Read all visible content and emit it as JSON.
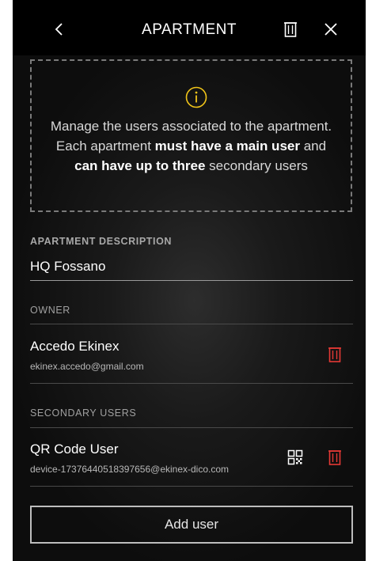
{
  "header": {
    "title": "APARTMENT"
  },
  "info": {
    "text_1": "Manage the users associated to the apartment. Each apartment ",
    "bold_1": "must have a main user",
    "text_2": " and ",
    "bold_2": "can have up to three",
    "text_3": " secondary users"
  },
  "description": {
    "label": "APARTMENT DESCRIPTION",
    "value": "HQ Fossano"
  },
  "owner": {
    "label": "OWNER",
    "name": "Accedo Ekinex",
    "email": "ekinex.accedo@gmail.com"
  },
  "secondary": {
    "label": "SECONDARY USERS",
    "users": [
      {
        "name": "QR Code User",
        "email": "device-17376440518397656@ekinex-dico.com"
      }
    ]
  },
  "add_user_label": "Add user",
  "colors": {
    "delete_red": "#e53935",
    "info_yellow": "#f0c419",
    "background": "#111111"
  },
  "icons": [
    "chevron-left-icon",
    "trash-icon",
    "close-icon",
    "info-icon",
    "qr-code-icon"
  ]
}
